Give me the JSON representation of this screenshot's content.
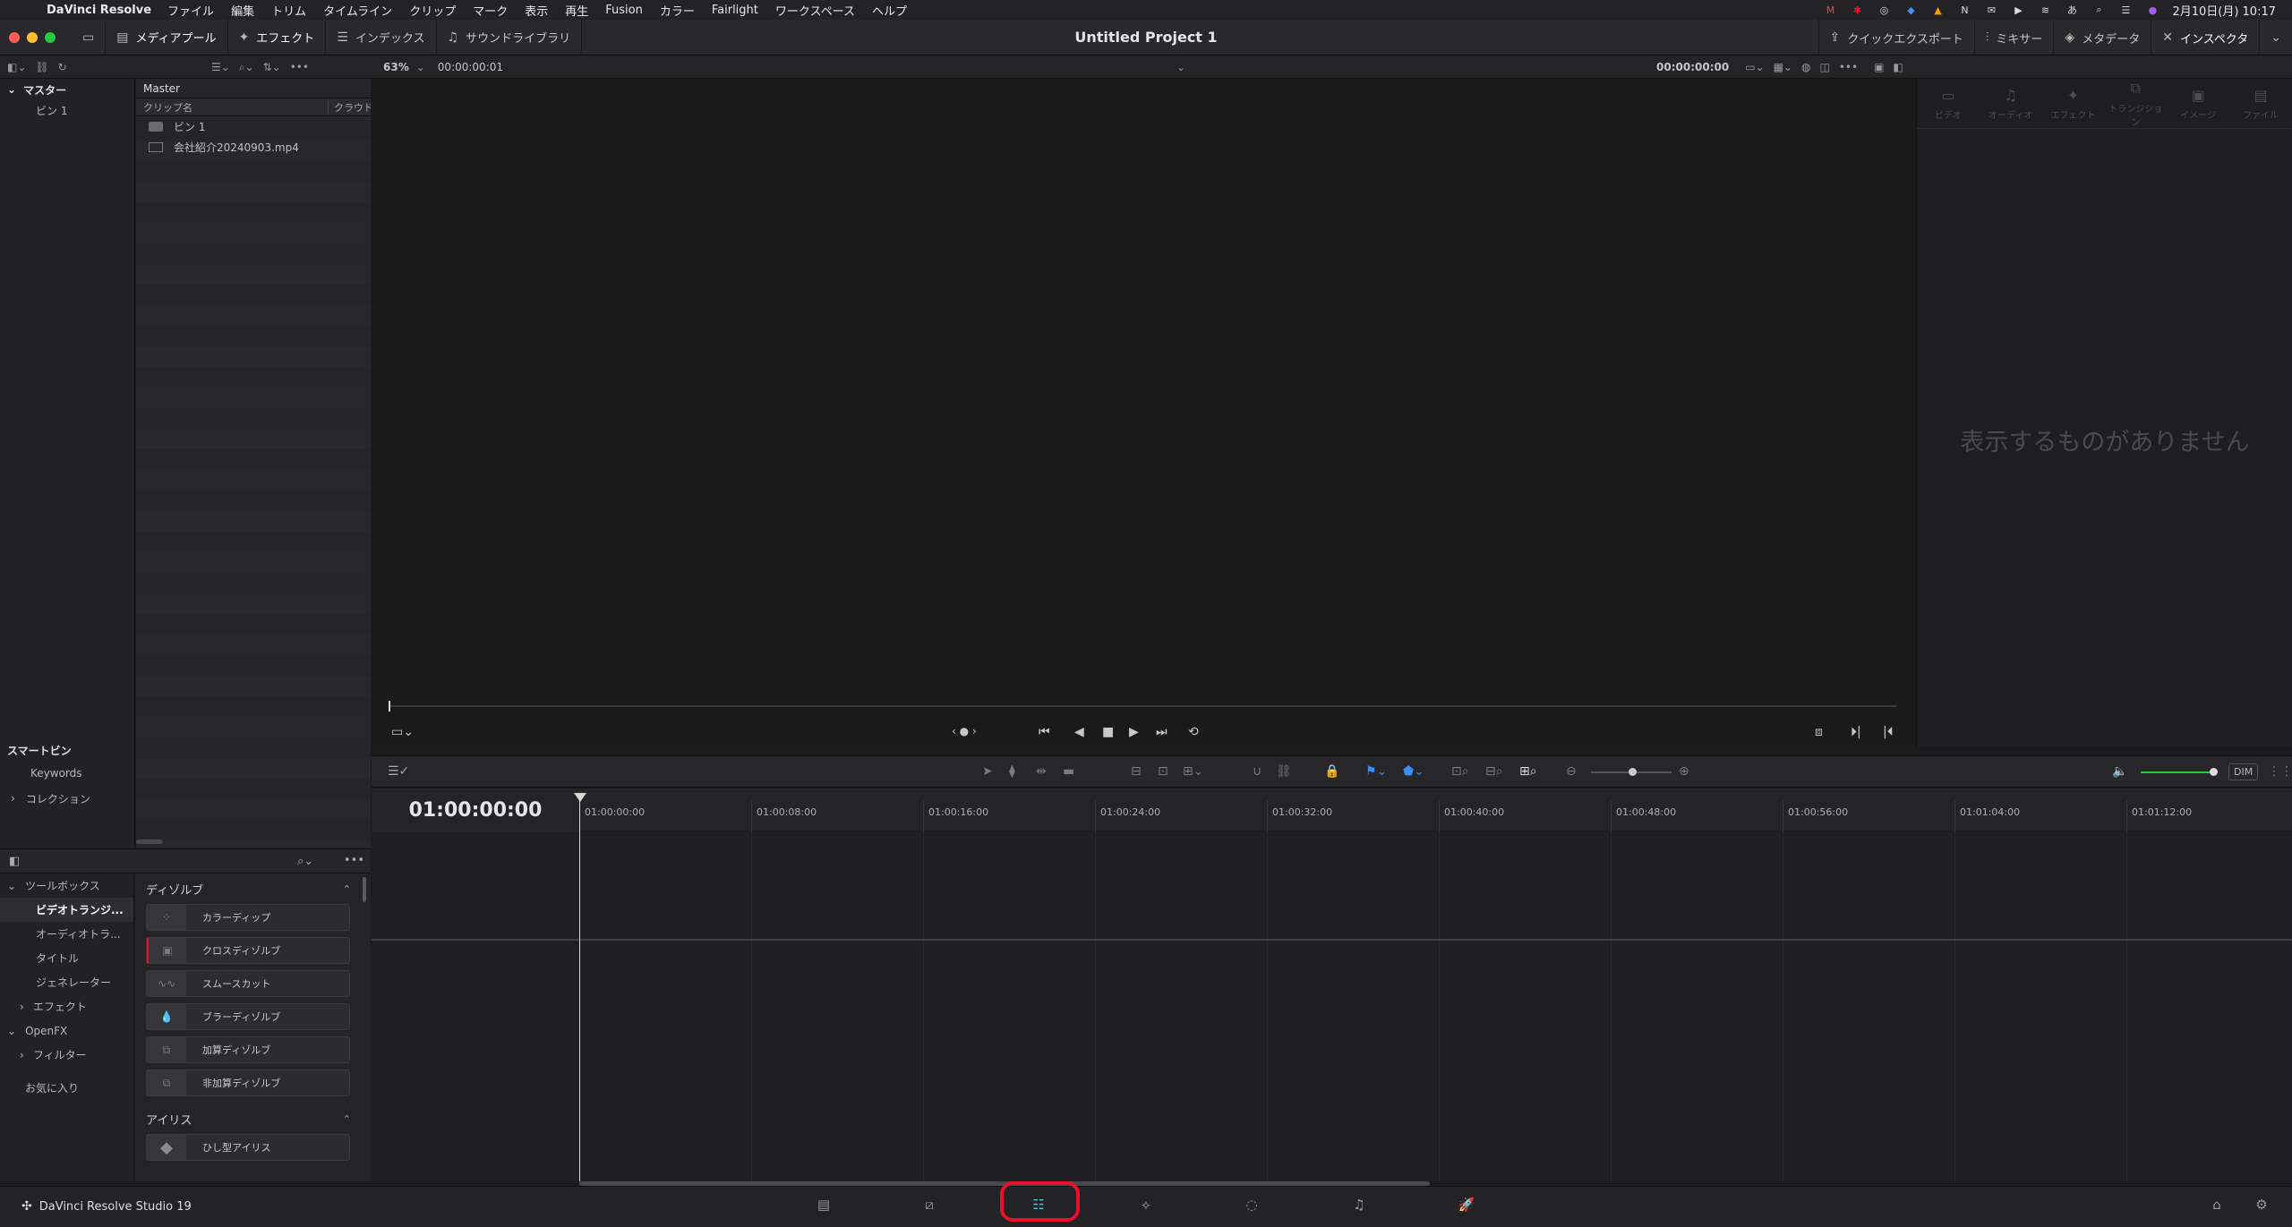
{
  "menubar": {
    "app_name": "DaVinci Resolve",
    "items": [
      "ファイル",
      "編集",
      "トリム",
      "タイムライン",
      "クリップ",
      "マーク",
      "表示",
      "再生",
      "Fusion",
      "カラー",
      "Fairlight",
      "ワークスペース",
      "ヘルプ"
    ],
    "clock": "2月10日(月) 10:17"
  },
  "header": {
    "project_title": "Untitled Project 1",
    "media_pool_label": "メディアプール",
    "effects_label": "エフェクト",
    "index_label": "インデックス",
    "sound_library_label": "サウンドライブラリ",
    "quick_export_label": "クイックエクスポート",
    "mixer_label": "ミキサー",
    "metadata_label": "メタデータ",
    "inspector_label": "インスペクタ"
  },
  "viewer": {
    "zoom": "63%",
    "source_timecode": "00:00:00:01",
    "record_timecode": "00:00:00:00"
  },
  "bins": {
    "master_label": "マスター",
    "bin1": "ビン 1"
  },
  "clips": {
    "header": "Master",
    "col_name": "クリップ名",
    "col_cloud": "クラウド同期",
    "rows": [
      "ビン 1",
      "会社紹介20240903.mp4"
    ]
  },
  "inspector": {
    "tabs": [
      "ビデオ",
      "オーディオ",
      "エフェクト",
      "トランジション",
      "イメージ",
      "ファイル"
    ],
    "empty_message": "表示するものがありません"
  },
  "smart_bins": {
    "label": "スマートビン",
    "keywords": "Keywords",
    "collections": "コレクション"
  },
  "timeline": {
    "timecode": "01:00:00:00",
    "dim_label": "DIM",
    "ruler": [
      "01:00:00:00",
      "01:00:08:00",
      "01:00:16:00",
      "01:00:24:00",
      "01:00:32:00",
      "01:00:40:00",
      "01:00:48:00",
      "01:00:56:00",
      "01:01:04:00",
      "01:01:12:00"
    ]
  },
  "effects_tree": {
    "toolbox": "ツールボックス",
    "video_transitions": "ビデオトランジ...",
    "audio_transitions": "オーディオトラ...",
    "titles": "タイトル",
    "generators": "ジェネレーター",
    "effects": "エフェクト",
    "openfx": "OpenFX",
    "filters": "フィルター",
    "favorites": "お気に入り"
  },
  "effects_list": {
    "group_dissolve": "ディゾルブ",
    "dissolve_items": [
      "カラーディップ",
      "クロスディゾルブ",
      "スムースカット",
      "ブラーディゾルブ",
      "加算ディゾルブ",
      "非加算ディゾルブ"
    ],
    "group_iris": "アイリス",
    "iris_items": [
      "ひし型アイリス"
    ]
  },
  "pagebar": {
    "brand": "DaVinci Resolve Studio 19"
  },
  "colors": {
    "accent": "#3ec6e6",
    "highlight_ring": "#e8102a",
    "traffic_red": "#ff5f57",
    "traffic_yellow": "#febc2e",
    "traffic_green": "#28c840"
  }
}
